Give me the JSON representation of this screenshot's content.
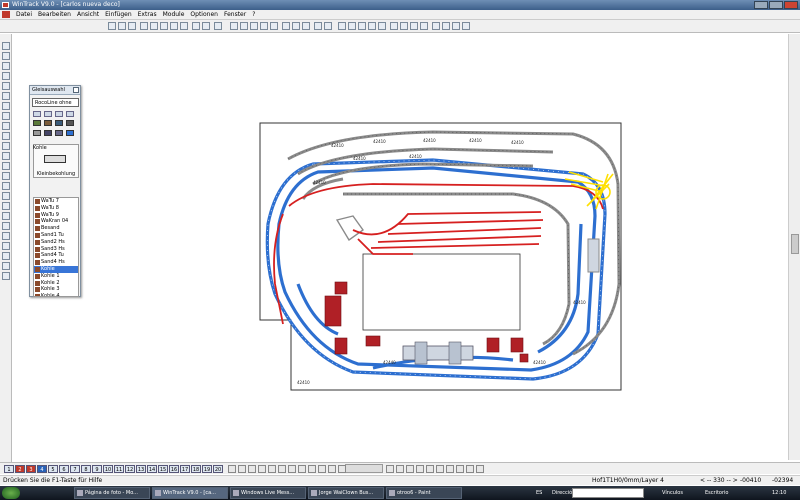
{
  "window": {
    "title": "WinTrack  V9.0 - [carlos nueva deco]"
  },
  "menu": [
    "Datei",
    "Bearbeiten",
    "Ansicht",
    "Einfügen",
    "Extras",
    "Module",
    "Optionen",
    "Fenster",
    "?"
  ],
  "panel": {
    "title": "Gleisauswahl",
    "select_value": "RocoLine ohne",
    "type_label": "Kohle",
    "info": "Kleinbekohlung",
    "items": [
      "WaTu 7",
      "WaTu 8",
      "WaTu 9",
      "WaKran 04",
      "Besand",
      "Sand1 Tu",
      "Sand2 Hs",
      "Sand3 Hs",
      "Sand4 Tu",
      "Sand4 Hs",
      "Kohle",
      "Kohle 1",
      "Kohle 2",
      "Kohle 3",
      "Kohle 4"
    ],
    "selected_index": 10
  },
  "layers": [
    "1",
    "2",
    "3",
    "4",
    "5",
    "6",
    "7",
    "8",
    "9",
    "10",
    "11",
    "12",
    "13",
    "14",
    "15",
    "16",
    "17",
    "18",
    "19",
    "20"
  ],
  "track_labels": [
    "42410",
    "42410",
    "42410",
    "42410",
    "42410",
    "42410",
    "42410",
    "42410",
    "42440",
    "42410",
    "42410",
    "42410"
  ],
  "status": {
    "help": "Drücken Sie die  F1-Taste für Hilfe",
    "layer": "Hof1T1H0/0mm/Layer 4",
    "zoom": "< -- 330 -- >",
    "x": "-00410",
    "y": "-02394"
  },
  "taskbar": {
    "tasks": [
      "Página de foto - Mo...",
      "WinTrack  V9.0 - [ca...",
      "Windows Live Mess...",
      "Jorge WaiClown Bus...",
      "otroo6 - Paint"
    ],
    "active_index": 1,
    "lang": "ES",
    "address_label": "Dirección",
    "links": "Vínculos",
    "desktop": "Escritorio",
    "clock": "12:10"
  },
  "colors": {
    "blue_track": "#2d6fd0",
    "red_track": "#d62020",
    "grey_track": "#8a8a8a",
    "highlight": "#ffe000"
  }
}
